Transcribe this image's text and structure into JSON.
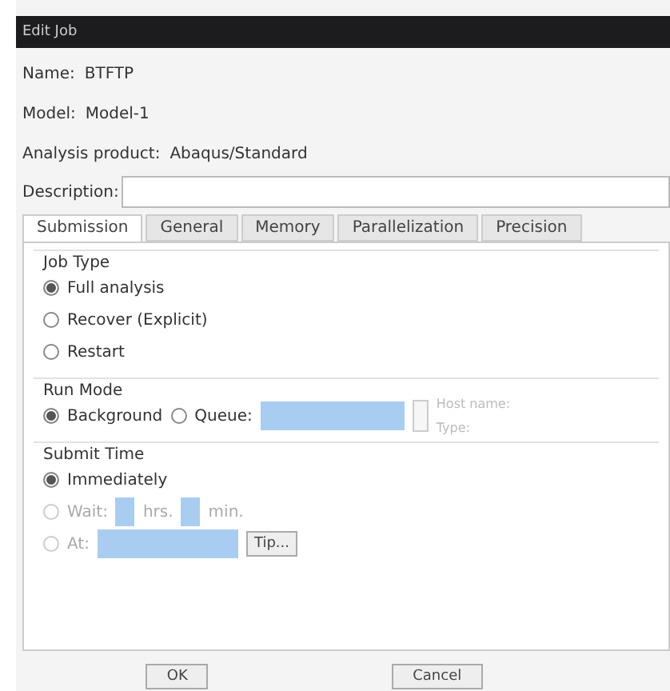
{
  "window": {
    "title": "Edit Job"
  },
  "info": [
    {
      "label": "Name:",
      "value": "BTFTP"
    },
    {
      "label": "Model:",
      "value": "Model-1"
    },
    {
      "label": "Analysis product:",
      "value": "Abaqus/Standard"
    }
  ],
  "description": {
    "label": "Description:"
  },
  "tabs": [
    {
      "label": "Submission",
      "selected": true
    },
    {
      "label": "General",
      "selected": false
    },
    {
      "label": "Memory",
      "selected": false
    },
    {
      "label": "Parallelization",
      "selected": false
    },
    {
      "label": "Precision",
      "selected": false
    }
  ],
  "job_type": {
    "title": "Job Type",
    "options": [
      {
        "label": "Full analysis",
        "selected": true
      },
      {
        "label": "Recover (Explicit)",
        "selected": false
      },
      {
        "label": "Restart",
        "selected": false
      }
    ]
  },
  "run_mode": {
    "title": "Run Mode",
    "background": {
      "label": "Background",
      "selected": true
    },
    "queue": {
      "label": "Queue:",
      "selected": false
    },
    "host_label": "Host name:",
    "type_label": "Type:"
  },
  "submit_time": {
    "title": "Submit Time",
    "immediately": {
      "label": "Immediately",
      "selected": true
    },
    "wait": {
      "label": "Wait:",
      "selected": false,
      "disabled": true,
      "hrs": "hrs.",
      "min": "min."
    },
    "at": {
      "label": "At:",
      "selected": false,
      "disabled": true,
      "button": "Tip..."
    }
  },
  "buttons": [
    "OK",
    "Cancel"
  ]
}
